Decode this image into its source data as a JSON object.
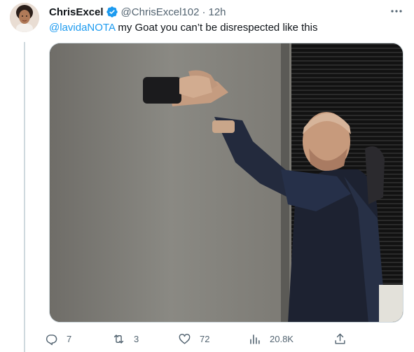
{
  "tweet": {
    "author_name": "ChrisExcel",
    "handle": "@ChrisExcel102",
    "separator": "·",
    "time": "12h",
    "mention": "@lavidaNOTA",
    "text": " my Goat you can’t be disrespected like this",
    "verified_color": "#1d9bf0"
  },
  "actions": {
    "replies": "7",
    "retweets": "3",
    "likes": "72",
    "views": "20.8K"
  }
}
